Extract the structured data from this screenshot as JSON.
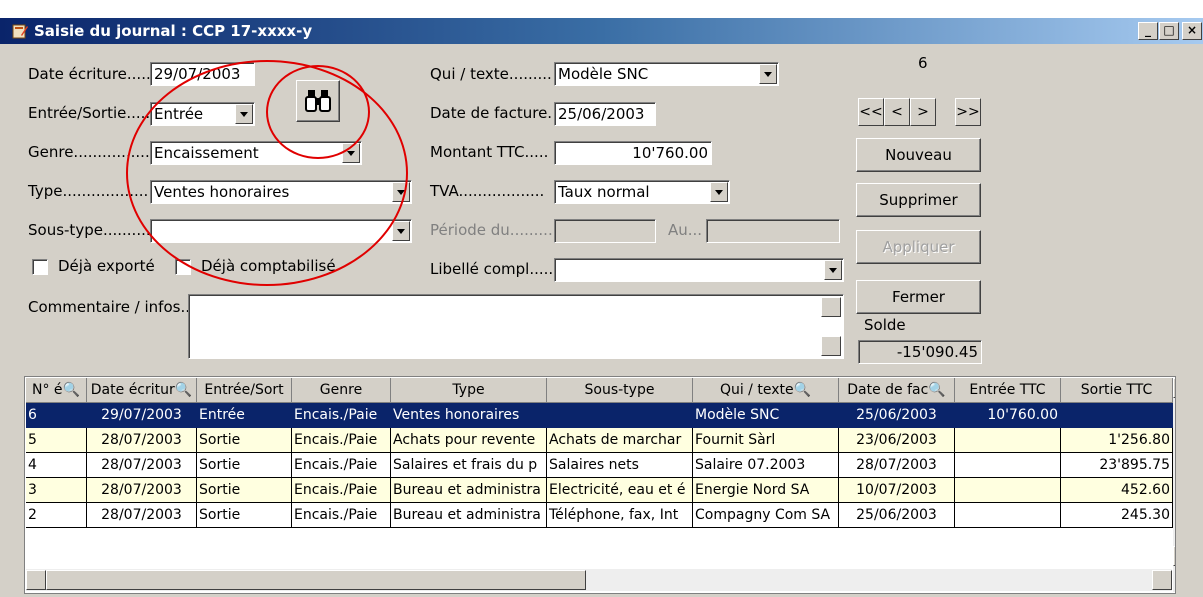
{
  "window": {
    "title": "Saisie du journal : CCP 17-xxxx-y",
    "minimize": "_",
    "maximize": "□",
    "close": "×"
  },
  "form": {
    "date_ecriture": {
      "label": "Date écriture.....",
      "value": "29/07/2003"
    },
    "entree_sortie": {
      "label": "Entrée/Sortie.....",
      "value": "Entrée"
    },
    "genre": {
      "label": "Genre.................",
      "value": "Encaissement"
    },
    "type": {
      "label": "Type..................",
      "value": "Ventes honoraires"
    },
    "sous_type": {
      "label": "Sous-type..........",
      "value": ""
    },
    "deja_exporte": {
      "label": "Déjà exporté",
      "checked": false
    },
    "deja_comptabilise": {
      "label": "Déjà comptabilisé",
      "checked": false
    },
    "commentaire": {
      "label": "Commentaire / infos..",
      "value": ""
    },
    "qui_texte": {
      "label": "Qui / texte.........",
      "value": "Modèle SNC"
    },
    "date_facture": {
      "label": "Date de facture.",
      "value": "25/06/2003"
    },
    "montant_ttc": {
      "label": "Montant TTC.....",
      "value": "10'760.00"
    },
    "tva": {
      "label": "TVA..................",
      "value": "Taux normal"
    },
    "periode_du": {
      "label": "Période du.........",
      "value": ""
    },
    "au": {
      "label": "Au...",
      "value": ""
    },
    "libelle": {
      "label": "Libellé compl......",
      "value": ""
    }
  },
  "nav": {
    "record_number": "6",
    "first": "<<",
    "prev": "<",
    "next": ">",
    "last": ">>",
    "nouveau": "Nouveau",
    "supprimer": "Supprimer",
    "appliquer": "Appliquer",
    "fermer": "Fermer",
    "solde_label": "Solde",
    "solde_value": "-15'090.45"
  },
  "table": {
    "columns": [
      "N° é",
      "Date écritur",
      "Entrée/Sort",
      "Genre",
      "Type",
      "Sous-type",
      "Qui / texte",
      "Date de fac",
      "Entrée TTC",
      "Sortie TTC"
    ],
    "rows": [
      [
        "6",
        "29/07/2003",
        "Entrée",
        "Encais./Paie",
        "Ventes honoraires",
        "",
        "Modèle SNC",
        "25/06/2003",
        "10'760.00",
        ""
      ],
      [
        "5",
        "28/07/2003",
        "Sortie",
        "Encais./Paie",
        "Achats pour revente",
        "Achats de marchar",
        "Fournit Sàrl",
        "23/06/2003",
        "",
        "1'256.80"
      ],
      [
        "4",
        "28/07/2003",
        "Sortie",
        "Encais./Paie",
        "Salaires et frais du p",
        "Salaires nets",
        "Salaire 07.2003",
        "28/07/2003",
        "",
        "23'895.75"
      ],
      [
        "3",
        "28/07/2003",
        "Sortie",
        "Encais./Paie",
        "Bureau et administra",
        "Electricité, eau et é",
        "Energie Nord SA",
        "10/07/2003",
        "",
        "452.60"
      ],
      [
        "2",
        "28/07/2003",
        "Sortie",
        "Encais./Paie",
        "Bureau et administra",
        "Téléphone, fax, Int",
        "Compagny Com SA",
        "25/06/2003",
        "",
        "245.30"
      ]
    ]
  },
  "colors": {
    "selection": "#0a246a",
    "alt_row": "#ffffe0",
    "annotation": "#e00000"
  }
}
